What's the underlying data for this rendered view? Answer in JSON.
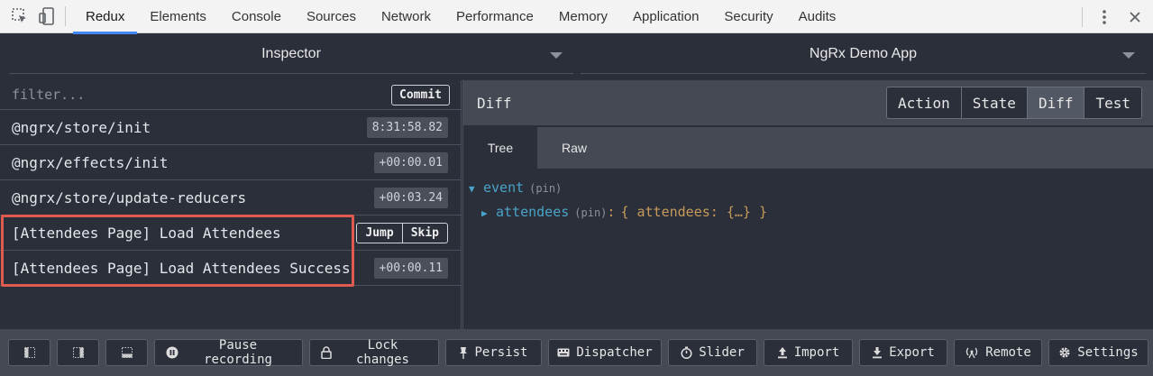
{
  "devtools": {
    "tabs": [
      "Redux",
      "Elements",
      "Console",
      "Sources",
      "Network",
      "Performance",
      "Memory",
      "Application",
      "Security",
      "Audits"
    ],
    "active_tab": "Redux"
  },
  "selectors": {
    "left": "Inspector",
    "right": "NgRx Demo App"
  },
  "left_panel": {
    "filter_placeholder": "filter...",
    "commit_label": "Commit",
    "actions": [
      {
        "name": "@ngrx/store/init",
        "time": "8:31:58.82"
      },
      {
        "name": "@ngrx/effects/init",
        "time": "+00:00.01"
      },
      {
        "name": "@ngrx/store/update-reducers",
        "time": "+00:03.24"
      },
      {
        "name": "[Attendees Page] Load Attendees",
        "jump": "Jump",
        "skip": "Skip"
      },
      {
        "name": "[Attendees Page] Load Attendees Success",
        "time": "+00:00.11"
      }
    ]
  },
  "right_panel": {
    "title": "Diff",
    "modes": [
      "Action",
      "State",
      "Diff",
      "Test"
    ],
    "active_mode": "Diff",
    "subtabs": [
      "Tree",
      "Raw"
    ],
    "active_subtab": "Tree",
    "tree": {
      "root_key": "event",
      "root_pin": "(pin)",
      "child_key": "attendees",
      "child_pin": "(pin)",
      "child_value": "{ attendees: {…} }"
    }
  },
  "toolbar": {
    "pause": "Pause recording",
    "lock": "Lock changes",
    "persist": "Persist",
    "dispatcher": "Dispatcher",
    "slider": "Slider",
    "import": "Import",
    "export": "Export",
    "remote": "Remote",
    "settings": "Settings"
  },
  "colors": {
    "accent_tab": "#4285f4",
    "panel_bg": "#2a2f3a",
    "header_bg": "#444953",
    "highlight": "#e05a4f",
    "key": "#4aa3c8",
    "value": "#c79a5a"
  }
}
